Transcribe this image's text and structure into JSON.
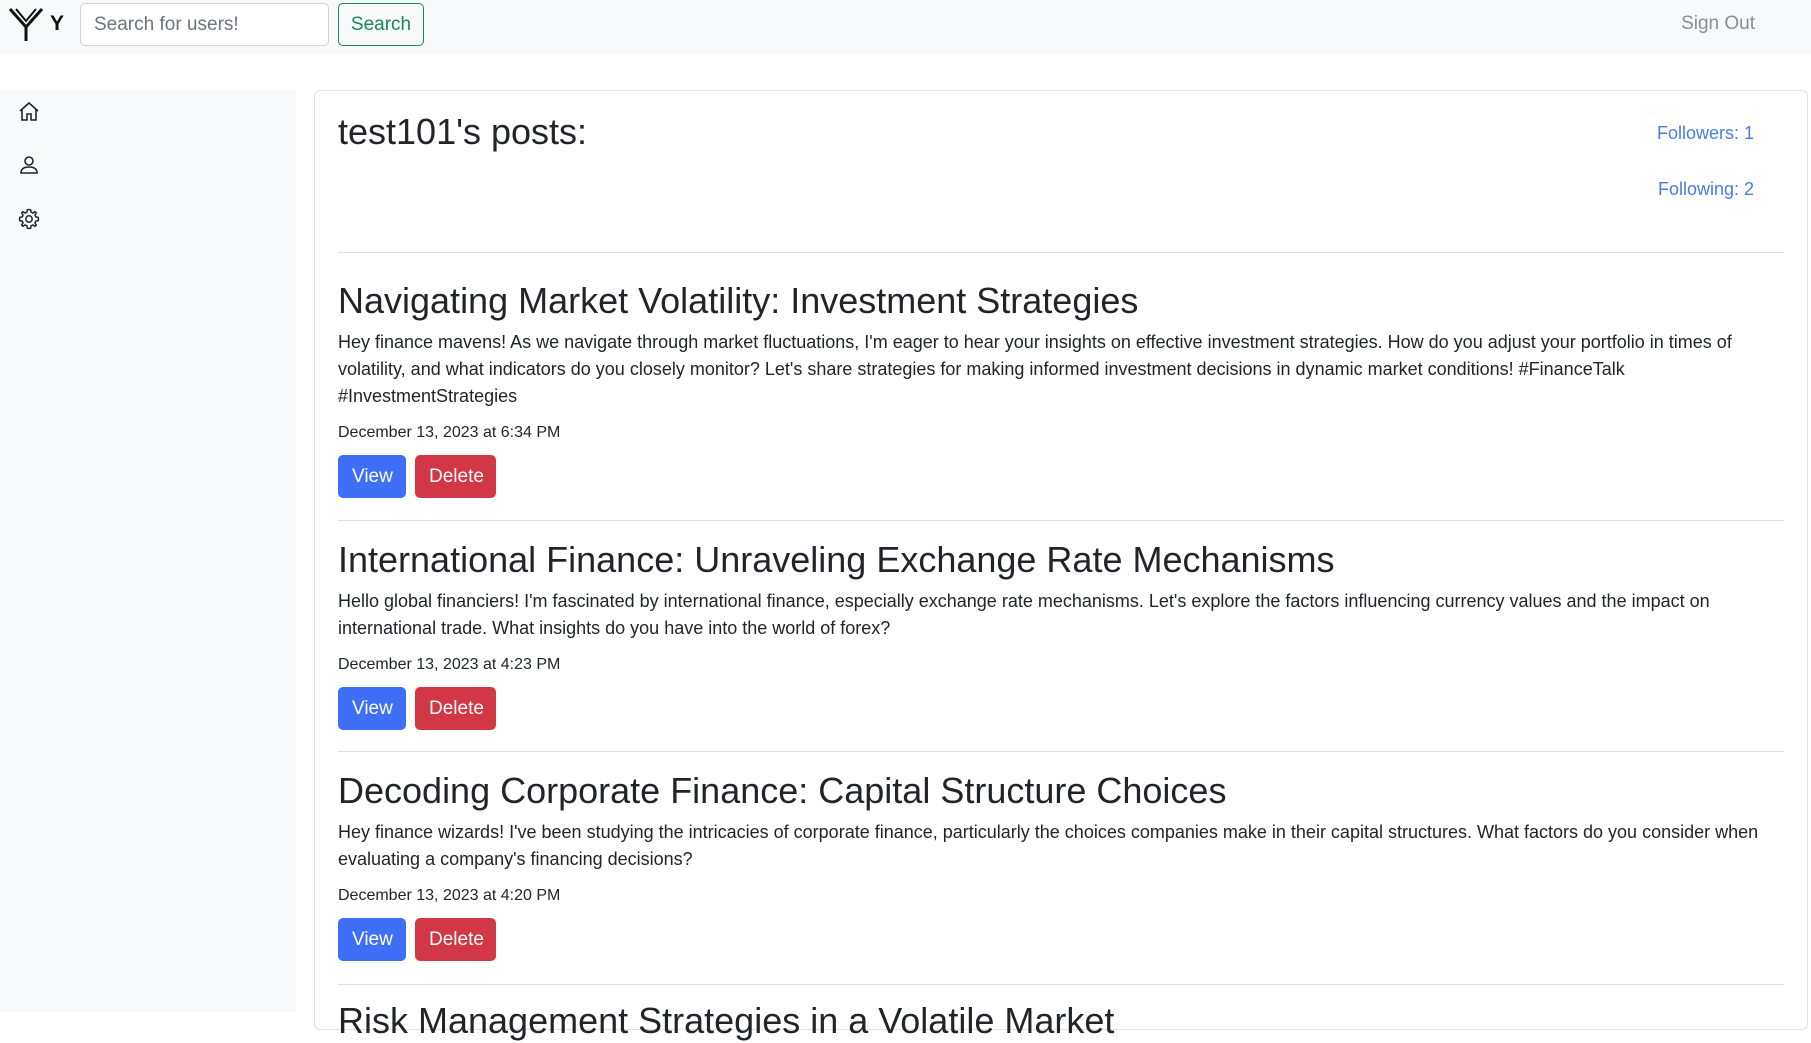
{
  "navbar": {
    "brand_text": "Y",
    "search_placeholder": "Search for users!",
    "search_value": "",
    "search_button": "Search",
    "signout_label": "Sign Out"
  },
  "sidebar": {
    "items": [
      {
        "icon": "home-icon"
      },
      {
        "icon": "user-icon"
      },
      {
        "icon": "gear-icon"
      }
    ]
  },
  "profile": {
    "title": "test101's posts:",
    "followers": "Followers: 1",
    "following": "Following: 2"
  },
  "posts": [
    {
      "title": "Navigating Market Volatility: Investment Strategies",
      "body": "Hey finance mavens! As we navigate through market fluctuations, I'm eager to hear your insights on effective investment strategies. How do you adjust your portfolio in times of volatility, and what indicators do you closely monitor? Let's share strategies for making informed investment decisions in dynamic market conditions! #FinanceTalk #InvestmentStrategies",
      "date": "December 13, 2023 at 6:34 PM",
      "view_label": "View",
      "delete_label": "Delete"
    },
    {
      "title": "International Finance: Unraveling Exchange Rate Mechanisms",
      "body": "Hello global financiers! I'm fascinated by international finance, especially exchange rate mechanisms. Let's explore the factors influencing currency values and the impact on international trade. What insights do you have into the world of forex?",
      "date": "December 13, 2023 at 4:23 PM",
      "view_label": "View",
      "delete_label": "Delete"
    },
    {
      "title": "Decoding Corporate Finance: Capital Structure Choices",
      "body": "Hey finance wizards! I've been studying the intricacies of corporate finance, particularly the choices companies make in their capital structures. What factors do you consider when evaluating a company's financing decisions?",
      "date": "December 13, 2023 at 4:20 PM",
      "view_label": "View",
      "delete_label": "Delete"
    },
    {
      "title": "Risk Management Strategies in a Volatile Market",
      "body": "",
      "date": "",
      "view_label": "",
      "delete_label": ""
    }
  ]
}
